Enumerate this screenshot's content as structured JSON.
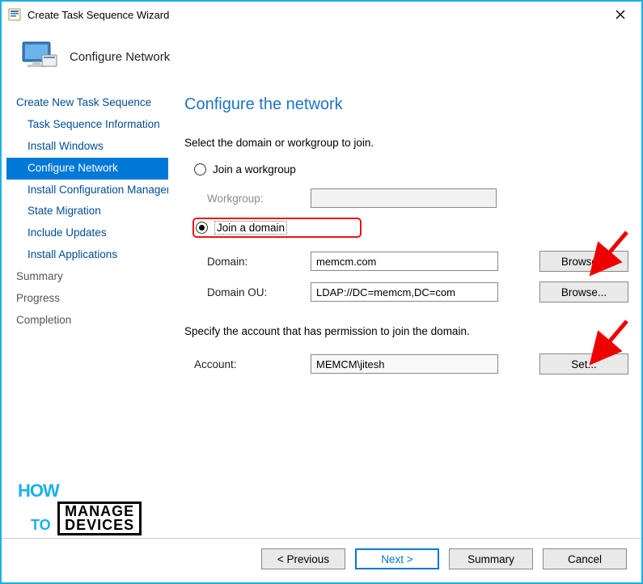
{
  "window": {
    "title": "Create Task Sequence Wizard",
    "close_tooltip": "Close"
  },
  "header": {
    "step_label": "Configure Network"
  },
  "nav": {
    "root": "Create New Task Sequence",
    "items": [
      "Task Sequence Information",
      "Install Windows",
      "Configure Network",
      "Install Configuration Manager",
      "State Migration",
      "Include Updates",
      "Install Applications"
    ],
    "selected_index": 2,
    "footer": [
      "Summary",
      "Progress",
      "Completion"
    ]
  },
  "panel": {
    "heading": "Configure the network",
    "intro": "Select the domain or workgroup to join.",
    "radio_workgroup": "Join a workgroup",
    "radio_domain": "Join a domain",
    "workgroup_label": "Workgroup:",
    "workgroup_value": "",
    "domain_label": "Domain:",
    "domain_value": "memcm.com",
    "domain_ou_label": "Domain OU:",
    "domain_ou_value": "LDAP://DC=memcm,DC=com",
    "browse_label": "Browse...",
    "account_intro": "Specify the account that has permission to join the domain.",
    "account_label": "Account:",
    "account_value": "MEMCM\\jitesh",
    "set_label": "Set..."
  },
  "buttons": {
    "previous": "< Previous",
    "next": "Next >",
    "summary": "Summary",
    "cancel": "Cancel"
  },
  "watermark": {
    "how": "HOW",
    "to": "TO",
    "manage": "MANAGE",
    "devices": "DEVICES"
  }
}
